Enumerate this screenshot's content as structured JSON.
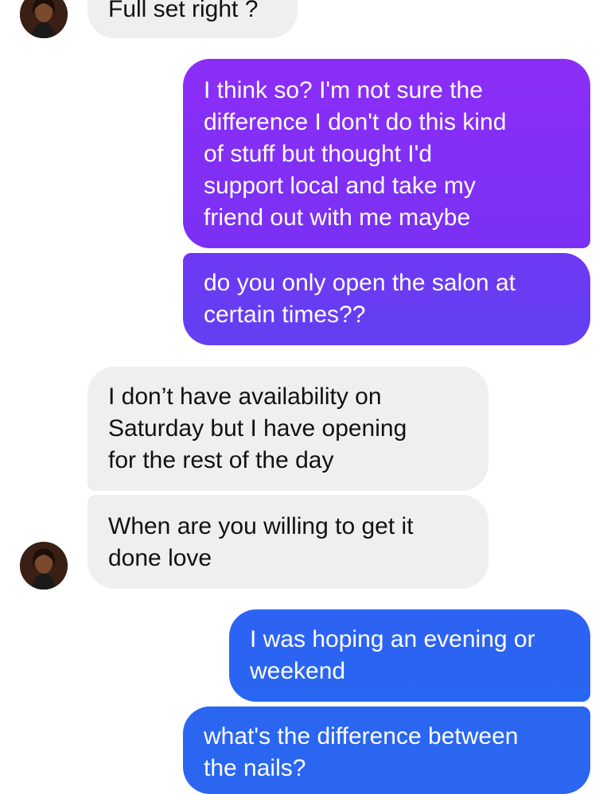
{
  "conversation": {
    "messages": [
      {
        "sender": "contact",
        "text": "Full set right ?"
      },
      {
        "sender": "me",
        "text": "I think so? I'm not sure the\ndifference I don't do this kind\nof stuff but thought I'd\nsupport local and take my\nfriend out with me maybe"
      },
      {
        "sender": "me",
        "text": "do you only open the salon at\ncertain times??"
      },
      {
        "sender": "contact",
        "text": "I don’t have availability on\nSaturday but I have opening\nfor the rest of the day"
      },
      {
        "sender": "contact",
        "text": "When are you willing to get it\ndone love"
      },
      {
        "sender": "me",
        "text": "I was hoping an evening or\nweekend"
      },
      {
        "sender": "me",
        "text": "what's the difference between\nthe nails?"
      }
    ]
  },
  "colors": {
    "incoming_bubble": "#efefef",
    "outgoing_purple": "#7a2cf5",
    "outgoing_blue": "#2a63f2",
    "background": "#ffffff"
  },
  "icons": {
    "contact_avatar": "contact-avatar-photo"
  }
}
